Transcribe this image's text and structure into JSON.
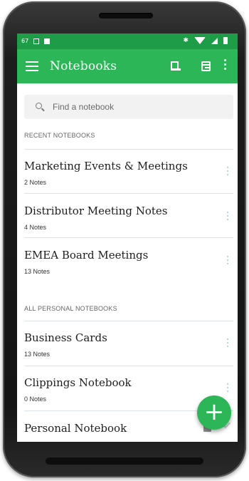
{
  "status_bar": {
    "time": "67"
  },
  "toolbar": {
    "title": "Notebooks",
    "icons": [
      "menu-icon",
      "notebook-icon",
      "sync-icon",
      "more-vert-icon"
    ]
  },
  "search": {
    "placeholder": "Find a notebook"
  },
  "sections": {
    "recent": "RECENT NOTEBOOKS",
    "personal": "ALL PERSONAL NOTEBOOKS"
  },
  "recent_notebooks": [
    {
      "name": "Marketing Events & Meetings",
      "count": "2 Notes"
    },
    {
      "name": "Distributor Meeting Notes",
      "count": "4 Notes"
    },
    {
      "name": "EMEA Board Meetings",
      "count": "13 Notes"
    }
  ],
  "personal_notebooks": [
    {
      "name": "Business Cards",
      "count": "13 Notes"
    },
    {
      "name": "Clippings Notebook",
      "count": "0 Notes"
    },
    {
      "name": "Personal Notebook",
      "count": ""
    }
  ],
  "fab": {
    "label": "+"
  },
  "colors": {
    "status_bar": "#1f9c48",
    "toolbar": "#2db657",
    "accent": "#2db657"
  }
}
